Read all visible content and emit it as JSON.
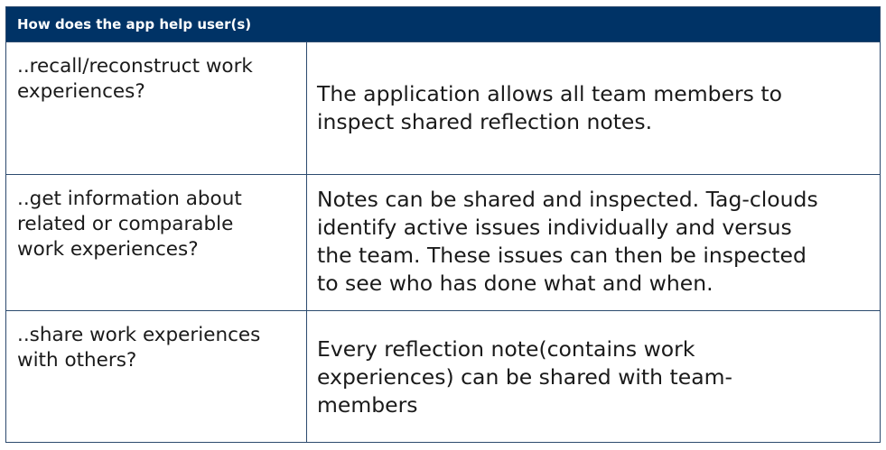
{
  "header": {
    "title": "How does the app help user(s)"
  },
  "rows": [
    {
      "question": "..recall/reconstruct work\nexperiences?",
      "answer": "The application allows all team members to\ninspect shared reflection notes."
    },
    {
      "question": "..get information about\nrelated or comparable\nwork experiences?",
      "answer": "Notes can be shared and inspected. Tag-clouds\nidentify active issues individually and versus\nthe team. These issues can then be inspected\nto see who has done what and when."
    },
    {
      "question": "..share work experiences\nwith others?",
      "answer": "Every reflection note(contains work\nexperiences) can be shared with team-\nmembers"
    }
  ],
  "colors": {
    "header_bg": "#003366",
    "header_text": "#ffffff",
    "border": "#2c4a6e"
  }
}
